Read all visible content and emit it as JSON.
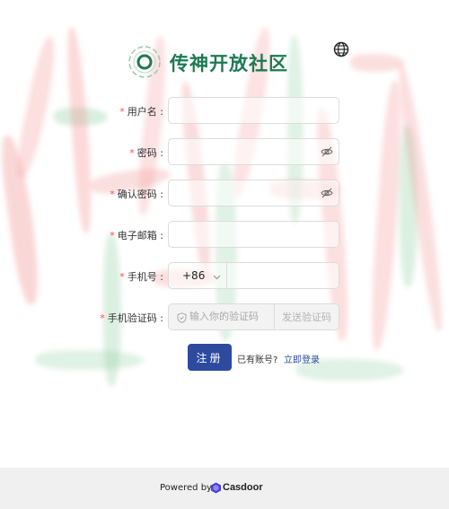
{
  "header": {
    "site_title": "传神开放社区"
  },
  "form": {
    "username": {
      "label": "用户名",
      "required_mark": "*",
      "value": ""
    },
    "password": {
      "label": "密码",
      "required_mark": "*",
      "value": ""
    },
    "confirm_password": {
      "label": "确认密码",
      "required_mark": "*",
      "value": ""
    },
    "email": {
      "label": "电子邮箱",
      "required_mark": "*",
      "value": ""
    },
    "phone": {
      "label": "手机号",
      "required_mark": "*",
      "country_code": "+86",
      "value": ""
    },
    "verification_code": {
      "label": "手机验证码",
      "required_mark": "*",
      "placeholder": "输入你的验证码",
      "send_label": "发送验证码"
    },
    "label_suffix": ":"
  },
  "actions": {
    "signup_label": "注册",
    "have_account_text": "已有账号?",
    "login_link": "立即登录"
  },
  "footer": {
    "powered_by": "Powered by",
    "brand": "Casdoor"
  },
  "colors": {
    "brand_green": "#1d7a52",
    "primary_blue": "#2d4a9f",
    "required_red": "#ff4d4f"
  }
}
